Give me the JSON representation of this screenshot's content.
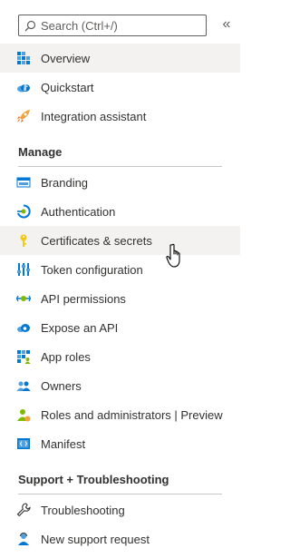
{
  "search": {
    "placeholder": "Search (Ctrl+/)",
    "icon": "search-icon"
  },
  "collapse": {
    "label": "«"
  },
  "top_items": [
    {
      "label": "Overview",
      "icon": "overview-grid-icon",
      "selected": true
    },
    {
      "label": "Quickstart",
      "icon": "quickstart-cloud-icon"
    },
    {
      "label": "Integration assistant",
      "icon": "rocket-icon"
    }
  ],
  "manage": {
    "title": "Manage",
    "items": [
      {
        "label": "Branding",
        "icon": "branding-icon"
      },
      {
        "label": "Authentication",
        "icon": "authentication-icon"
      },
      {
        "label": "Certificates & secrets",
        "icon": "key-icon",
        "hovered": true
      },
      {
        "label": "Token configuration",
        "icon": "token-sliders-icon"
      },
      {
        "label": "API permissions",
        "icon": "api-permissions-icon"
      },
      {
        "label": "Expose an API",
        "icon": "cloud-icon"
      },
      {
        "label": "App roles",
        "icon": "app-roles-grid-icon"
      },
      {
        "label": "Owners",
        "icon": "owners-people-icon"
      },
      {
        "label": "Roles and administrators | Preview",
        "icon": "roles-admin-icon"
      },
      {
        "label": "Manifest",
        "icon": "manifest-icon"
      }
    ]
  },
  "support": {
    "title": "Support + Troubleshooting",
    "items": [
      {
        "label": "Troubleshooting",
        "icon": "wrench-icon"
      },
      {
        "label": "New support request",
        "icon": "support-person-icon"
      }
    ]
  },
  "colors": {
    "hover_bg": "#f3f2f1",
    "text": "#323130",
    "accent_blue": "#0078d4",
    "divider": "#c8c6c4"
  }
}
